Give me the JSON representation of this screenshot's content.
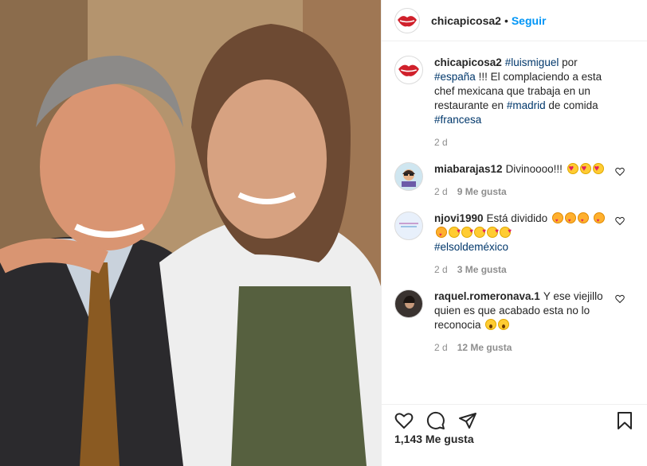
{
  "header": {
    "username": "chicapicosa2",
    "separator": "•",
    "follow_label": "Seguir"
  },
  "caption": {
    "username": "chicapicosa2",
    "tag1": "#luismiguel",
    "text1": " por ",
    "tag2": "#españa",
    "text2": " !!! El complaciendo a esta chef mexicana que trabaja en un restaurante en ",
    "tag3": "#madrid",
    "text3": " de comida ",
    "tag4": "#francesa",
    "time": "2 d"
  },
  "comments": [
    {
      "username": "miabarajas12",
      "text": "Divinoooo!!!",
      "time": "2 d",
      "likes": "9 Me gusta"
    },
    {
      "username": "njovi1990",
      "text": "Está dividido",
      "tag": "#elsoldeméxico",
      "time": "2 d",
      "likes": "3 Me gusta"
    },
    {
      "username": "raquel.romeronava.1",
      "text": "Y ese viejillo quien es que acabado esta no lo reconocia",
      "time": "2 d",
      "likes": "12 Me gusta"
    }
  ],
  "actions": {
    "like": "heart-icon",
    "comment": "comment-icon",
    "share": "share-icon",
    "save": "bookmark-icon"
  },
  "likes_count": "1,143 Me gusta"
}
